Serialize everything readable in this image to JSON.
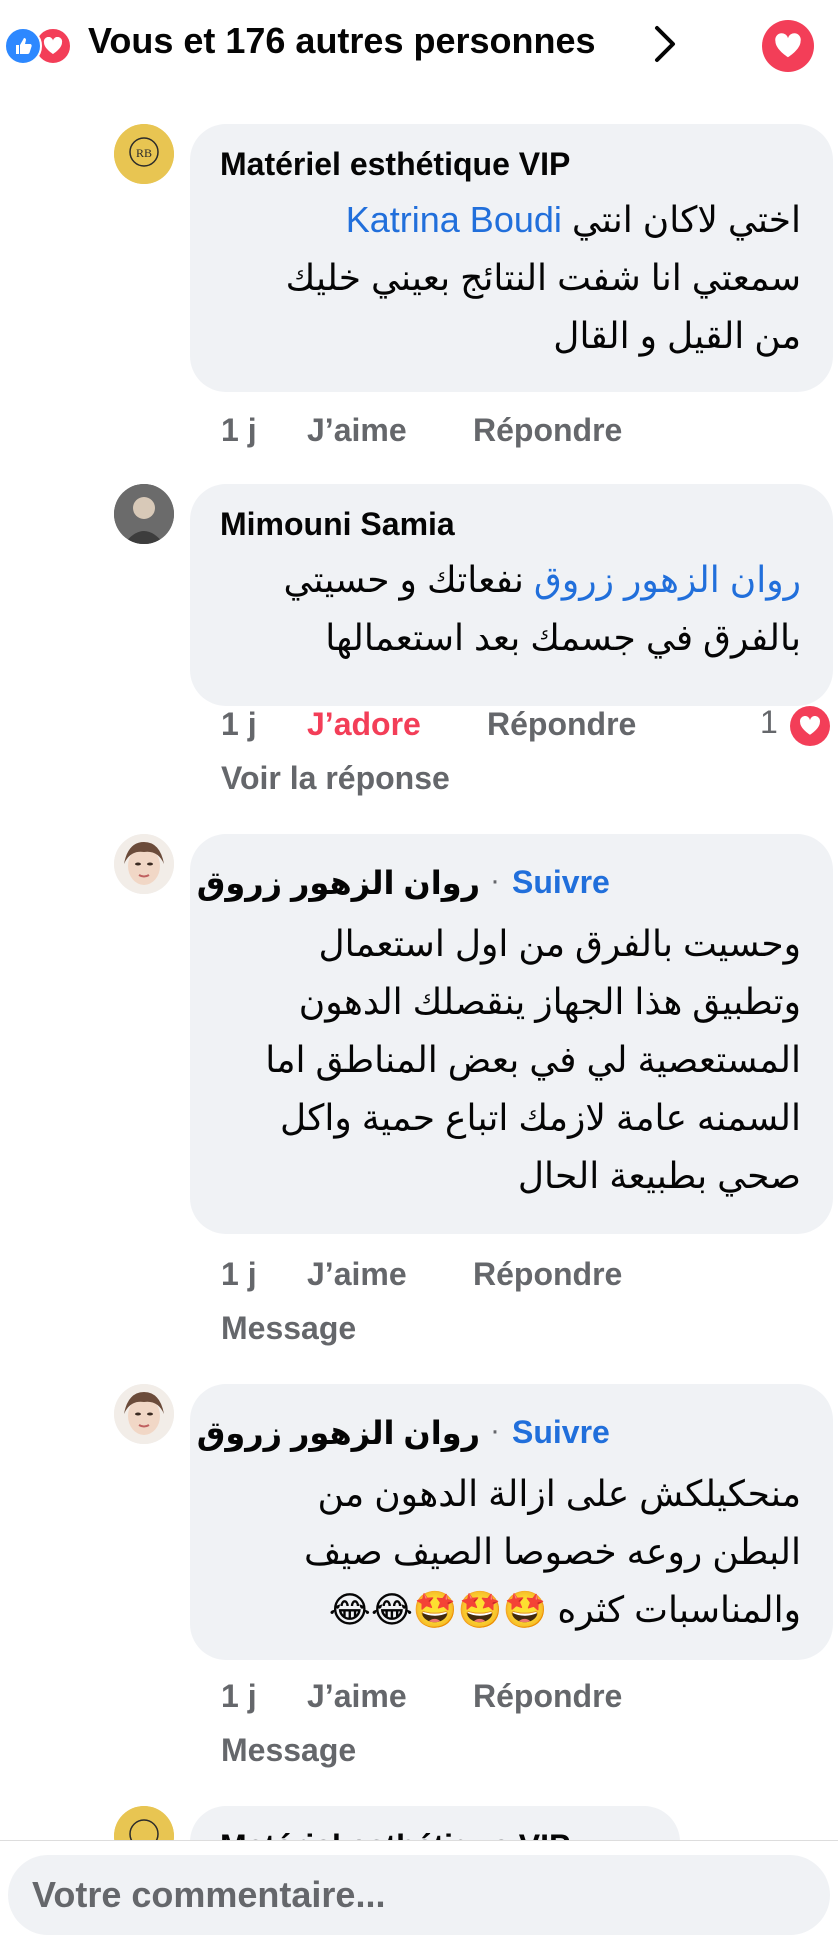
{
  "reactions": {
    "summary": "Vous et 176 autres personnes"
  },
  "comments": [
    {
      "author": "Matériel esthétique VIP",
      "mention": "Katrina Boudi",
      "line1_rest": "اختي لاكان انتي",
      "line2": "سمعتي انا شفت النتائج  بعيني خليك",
      "line3": "من القيل و القال",
      "time": "1 j",
      "like_label": "J’aime",
      "reply_label": "Répondre"
    },
    {
      "author": "Mimouni Samia",
      "mention": "روان الزهور زروق",
      "line1_rest": "نفعاتك و حسيتي",
      "line2": "بالفرق في جسمك بعد استعمالها",
      "time": "1 j",
      "like_label": "J’adore",
      "reply_label": "Répondre",
      "reaction_count": "1",
      "sub_link": "Voir la réponse"
    },
    {
      "author": "روان الزهور زروق",
      "follow_label": "Suivre",
      "lines": [
        "وحسيت بالفرق من اول استعمال",
        "وتطبيق هذا الجهاز ينقصلك الدهون",
        "المستعصية لي في بعض المناطق اما",
        "السمنه عامة لازمك اتباع حمية واكل",
        "صحي بطبيعة الحال"
      ],
      "time": "1 j",
      "like_label": "J’aime",
      "reply_label": "Répondre",
      "sub_link": "Message"
    },
    {
      "author": "روان الزهور زروق",
      "follow_label": "Suivre",
      "lines": [
        "منحكيلكش على  ازالة الدهون من",
        "البطن روعه خصوصا الصيف صيف",
        "والمناسبات كثره 🤩🤩🤩😂😂"
      ],
      "time": "1 j",
      "like_label": "J’aime",
      "reply_label": "Répondre",
      "sub_link": "Message"
    },
    {
      "author": "Matériel esthétique VIP"
    }
  ],
  "input": {
    "placeholder": "Votre commentaire..."
  },
  "colors": {
    "accent_blue": "#216fdb",
    "love_red": "#f33e58",
    "muted": "#65676b",
    "bubble_bg": "#f0f2f5"
  }
}
